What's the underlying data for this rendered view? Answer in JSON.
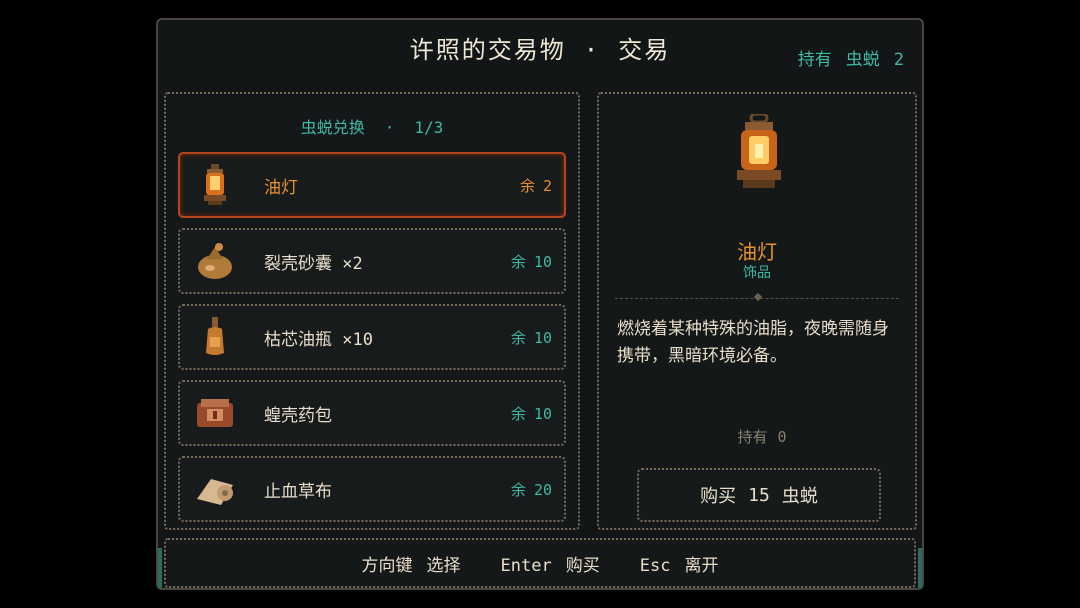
{
  "header": {
    "title": "许照的交易物",
    "separator": "·",
    "subtitle": "交易",
    "held_label": "持有",
    "currency": "虫蜕",
    "held_count": "2"
  },
  "list": {
    "page_label": "虫蜕兑换",
    "page_sep": "·",
    "page": "1/3",
    "items": [
      {
        "name": "油灯",
        "stock_label": "余",
        "stock": "2",
        "icon": "oil-lamp-icon"
      },
      {
        "name": "裂壳砂囊 ×2",
        "stock_label": "余",
        "stock": "10",
        "icon": "sand-pouch-icon"
      },
      {
        "name": "枯芯油瓶 ×10",
        "stock_label": "余",
        "stock": "10",
        "icon": "oil-bottle-icon"
      },
      {
        "name": "蝗壳药包",
        "stock_label": "余",
        "stock": "10",
        "icon": "medicine-pack-icon"
      },
      {
        "name": "止血草布",
        "stock_label": "余",
        "stock": "20",
        "icon": "bandage-icon"
      }
    ]
  },
  "detail": {
    "name": "油灯",
    "type": "饰品",
    "description": "燃烧着某种特殊的油脂，夜晚需随身携带，黑暗环境必备。",
    "held_label": "持有",
    "held": "0",
    "buy_label": "购买",
    "price": "15",
    "currency": "虫蜕"
  },
  "footer": {
    "k1": "方向键",
    "a1": "选择",
    "k2": "Enter",
    "a2": "购买",
    "k3": "Esc",
    "a3": "离开"
  },
  "colors": {
    "accent": "#e8902e",
    "teal": "#3fb8a4",
    "selected_border": "#b5441f"
  }
}
